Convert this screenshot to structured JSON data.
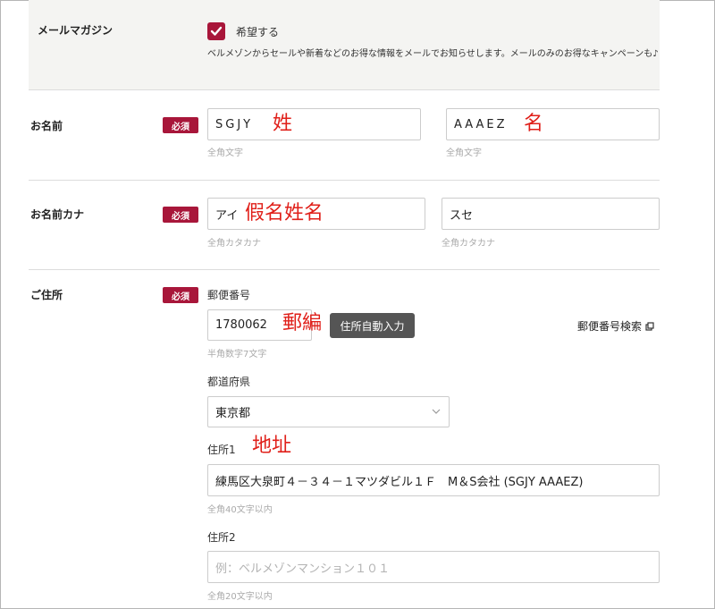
{
  "newsletter": {
    "label": "メールマガジン",
    "checkbox_label": "希望する",
    "checked": true,
    "description": "ベルメゾンからセールや新着などのお得な情報をメールでお知らせします。メールのみのお得なキャンペーンも♪"
  },
  "required_badge": "必須",
  "name": {
    "label": "お名前",
    "last_name_value": "SGJY",
    "first_name_value": "AAAEZ",
    "hint": "全角文字",
    "annotation_last": "姓",
    "annotation_first": "名"
  },
  "kana": {
    "label": "お名前カナ",
    "last_kana_value": "アイ",
    "first_kana_value": "スセ",
    "hint": "全角カタカナ",
    "annotation": "假名姓名"
  },
  "address": {
    "label": "ご住所",
    "postal_label": "郵便番号",
    "postal_value": "1780062",
    "postal_hint": "半角数字7文字",
    "postal_annotation": "郵編",
    "auto_fill_button": "住所自動入力",
    "postal_search_link": "郵便番号検索",
    "prefecture_label": "都道府県",
    "prefecture_value": "東京都",
    "address1_label": "住所1",
    "address1_annotation": "地址",
    "address1_value": "練馬区大泉町４－３４－１マツダビル１Ｆ　M＆S会社 (SGJY AAAEZ)",
    "address1_hint": "全角40文字以内",
    "address2_label": "住所2",
    "address2_placeholder": "例：ベルメゾンマンション１０１",
    "address2_hint": "全角20文字以内"
  },
  "colors": {
    "accent": "#a8163a",
    "annotation": "#e0201a",
    "button_bg": "#555555",
    "band_bg": "#f4f4f2"
  },
  "icons": {
    "check": "check-icon",
    "chevron": "chevron-down-icon",
    "external": "external-link-icon"
  }
}
